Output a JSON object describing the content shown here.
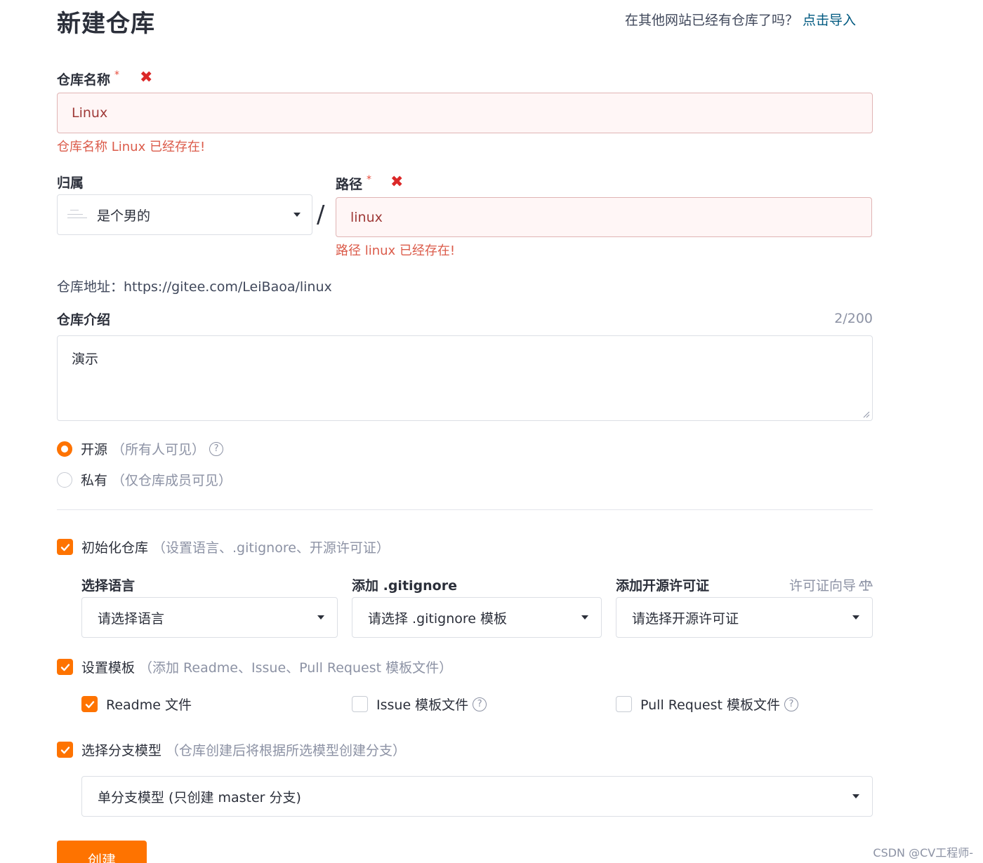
{
  "header": {
    "title": "新建仓库",
    "import_question": "在其他网站已经有仓库了吗？",
    "import_link": "点击导入"
  },
  "repo_name": {
    "label": "仓库名称",
    "required_mark": "*",
    "error_icon": "✖",
    "value": "Linux",
    "error": "仓库名称 Linux 已经存在!"
  },
  "owner": {
    "label": "归属",
    "value": "是个男的",
    "avatar_icon": "avatar-thumbnail"
  },
  "separator": "/",
  "path": {
    "label": "路径",
    "required_mark": "*",
    "error_icon": "✖",
    "value": "linux",
    "error": "路径 linux 已经存在!"
  },
  "repo_url": {
    "label": "仓库地址：",
    "value": "https://gitee.com/LeiBaoa/linux"
  },
  "description": {
    "label": "仓库介绍",
    "counter": "2/200",
    "value": "演示"
  },
  "visibility": {
    "options": [
      {
        "label": "开源",
        "hint": "（所有人可见）",
        "selected": true,
        "help": "?"
      },
      {
        "label": "私有",
        "hint": "（仅仓库成员可见）",
        "selected": false
      }
    ]
  },
  "init_repo": {
    "checked": true,
    "label": "初始化仓库",
    "hint": "（设置语言、.gitignore、开源许可证）",
    "language": {
      "label": "选择语言",
      "placeholder": "请选择语言"
    },
    "gitignore": {
      "label": "添加 .gitignore",
      "placeholder": "请选择 .gitignore 模板"
    },
    "license": {
      "label": "添加开源许可证",
      "guide": "许可证向导",
      "guide_icon": "scale-icon",
      "placeholder": "请选择开源许可证"
    }
  },
  "templates": {
    "checked": true,
    "label": "设置模板",
    "hint": "（添加 Readme、Issue、Pull Request 模板文件）",
    "items": [
      {
        "label": "Readme 文件",
        "checked": true
      },
      {
        "label": "Issue 模板文件",
        "checked": false,
        "help": "?"
      },
      {
        "label": "Pull Request 模板文件",
        "checked": false,
        "help": "?"
      }
    ]
  },
  "branch_model": {
    "checked": true,
    "label": "选择分支模型",
    "hint": "（仓库创建后将根据所选模型创建分支）",
    "value": "单分支模型 (只创建 master 分支)"
  },
  "create_button": "创建",
  "watermark": "CSDN @CV工程师-",
  "colors": {
    "accent": "#fe7300",
    "error_text": "#9f3a38",
    "error_bg": "#fff6f6",
    "error_border": "#e0b4b4",
    "link": "#005980"
  }
}
